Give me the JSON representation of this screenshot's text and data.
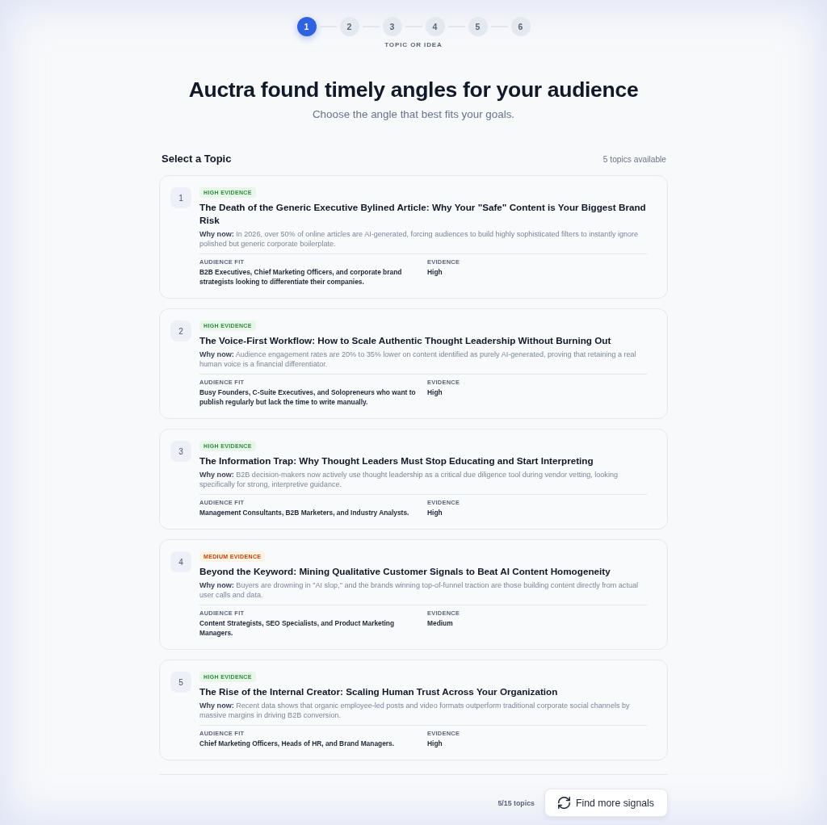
{
  "stepper": {
    "steps": [
      {
        "label": "1",
        "selected": true
      },
      {
        "label": "2",
        "selected": false
      },
      {
        "label": "3",
        "selected": false
      },
      {
        "label": "4",
        "selected": false
      },
      {
        "label": "5",
        "selected": false
      },
      {
        "label": "6",
        "selected": false
      }
    ],
    "caption": "TOPIC OR IDEA"
  },
  "header": {
    "title": "Auctra found timely angles for your audience",
    "subtitle": "Choose the angle that best fits your goals."
  },
  "section": {
    "title": "Select a Topic",
    "count": "5 topics available"
  },
  "topics": [
    {
      "number": "1",
      "selected": false,
      "kind": "high",
      "badge": "HIGH EVIDENCE",
      "title": "The Death of the Generic Executive Bylined Article: Why Your \"Safe\" Content is Your Biggest Brand Risk",
      "why_now": "**Why now:** In 2026, over 50% of online articles are AI-generated, forcing audiences to build highly sophisticated filters to instantly ignore polished but generic corporate boilerplate.",
      "audience_fit_label": "AUDIENCE FIT",
      "audience_fit": "B2B Executives, Chief Marketing Officers, and corporate brand strategists looking to differentiate their companies.",
      "evidence_label": "EVIDENCE",
      "evidence": "High"
    },
    {
      "number": "2",
      "selected": false,
      "kind": "high",
      "badge": "HIGH EVIDENCE",
      "title": "The Voice-First Workflow: How to Scale Authentic Thought Leadership Without Burning Out",
      "why_now": "**Why now:** Audience engagement rates are 20% to 35% lower on content identified as purely AI-generated, proving that retaining a real human voice is a financial differentiator.",
      "audience_fit_label": "AUDIENCE FIT",
      "audience_fit": "Busy Founders, C-Suite Executives, and Solopreneurs who want to publish regularly but lack the time to write manually.",
      "evidence_label": "EVIDENCE",
      "evidence": "High"
    },
    {
      "number": "3",
      "selected": false,
      "kind": "high",
      "badge": "HIGH EVIDENCE",
      "title": "The Information Trap: Why Thought Leaders Must Stop Educating and Start Interpreting",
      "why_now": "**Why now:** B2B decision-makers now actively use thought leadership as a critical due diligence tool during vendor vetting, looking specifically for strong, interpretive guidance.",
      "audience_fit_label": "AUDIENCE FIT",
      "audience_fit": "Management Consultants, B2B Marketers, and Industry Analysts.",
      "evidence_label": "EVIDENCE",
      "evidence": "High"
    },
    {
      "number": "4",
      "selected": false,
      "kind": "medium",
      "badge": "MEDIUM EVIDENCE",
      "title": "Beyond the Keyword: Mining Qualitative Customer Signals to Beat AI Content Homogeneity",
      "why_now": "**Why now:** Buyers are drowning in \"AI slop,\" and the brands winning top-of-funnel traction are those building content directly from actual user calls and data.",
      "audience_fit_label": "AUDIENCE FIT",
      "audience_fit": "Content Strategists, SEO Specialists, and Product Marketing Managers.",
      "evidence_label": "EVIDENCE",
      "evidence": "Medium"
    },
    {
      "number": "5",
      "selected": false,
      "kind": "high",
      "badge": "HIGH EVIDENCE",
      "title": "The Rise of the Internal Creator: Scaling Human Trust Across Your Organization",
      "why_now": "**Why now:** Recent data shows that organic employee-led posts and video formats outperform traditional corporate social channels by massive margins in driving B2B conversion.",
      "audience_fit_label": "AUDIENCE FIT",
      "audience_fit": "Chief Marketing Officers, Heads of HR, and Brand Managers.",
      "evidence_label": "EVIDENCE",
      "evidence": "High"
    }
  ],
  "footer": {
    "count": "5/15 topics",
    "button": "Find more signals"
  }
}
